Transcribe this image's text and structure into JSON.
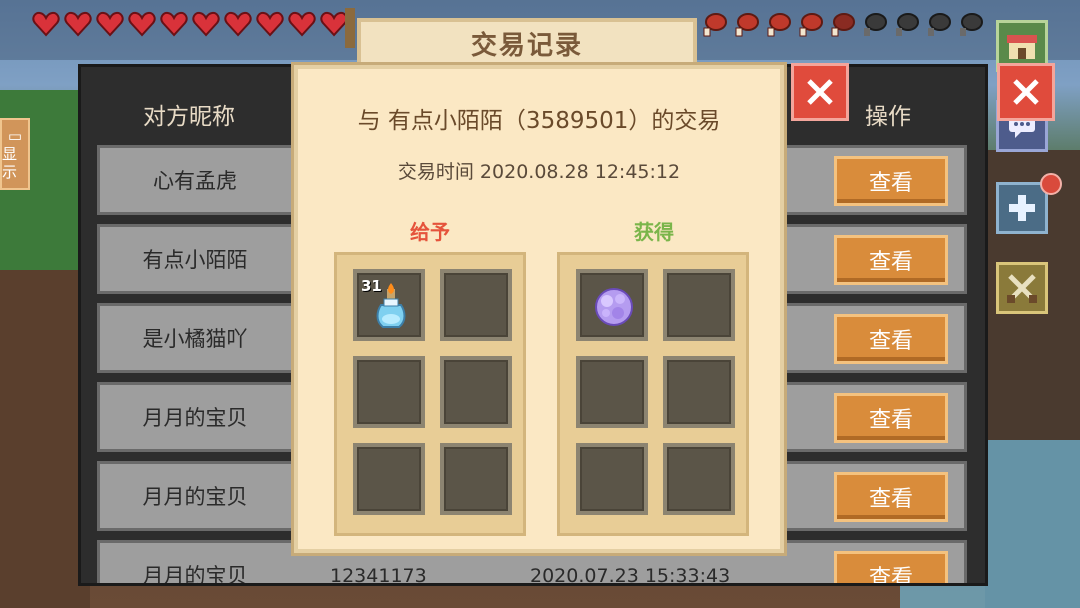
{
  "hud": {
    "hearts": 10,
    "hunger": 10
  },
  "title": "交易记录",
  "list": {
    "col_nickname": "对方昵称",
    "col_action": "操作",
    "rows": [
      {
        "nickname": "心有孟虎",
        "button": "查看"
      },
      {
        "nickname": "有点小陌陌",
        "button": "查看"
      },
      {
        "nickname": "是小橘猫吖",
        "button": "查看"
      },
      {
        "nickname": "月月的宝贝",
        "button": "查看"
      },
      {
        "nickname": "月月的宝贝",
        "button": "查看"
      },
      {
        "nickname": "月月的宝贝",
        "id": "12341173",
        "time": "2020.07.23 15:33:43",
        "button": "查看"
      }
    ]
  },
  "left_tab": "显示",
  "dialog": {
    "title": "与 有点小陌陌（3589501）的交易",
    "time": "交易时间 2020.08.28 12:45:12",
    "give_label": "给予",
    "get_label": "获得",
    "give_item": {
      "name": "potion-bottle-icon",
      "count": "31"
    },
    "get_item": {
      "name": "purple-ore-icon"
    }
  },
  "colors": {
    "accent_button": "#d98c3b",
    "close_red": "#e04b3c",
    "give_red": "#e5533b",
    "get_green": "#7ab54a"
  }
}
